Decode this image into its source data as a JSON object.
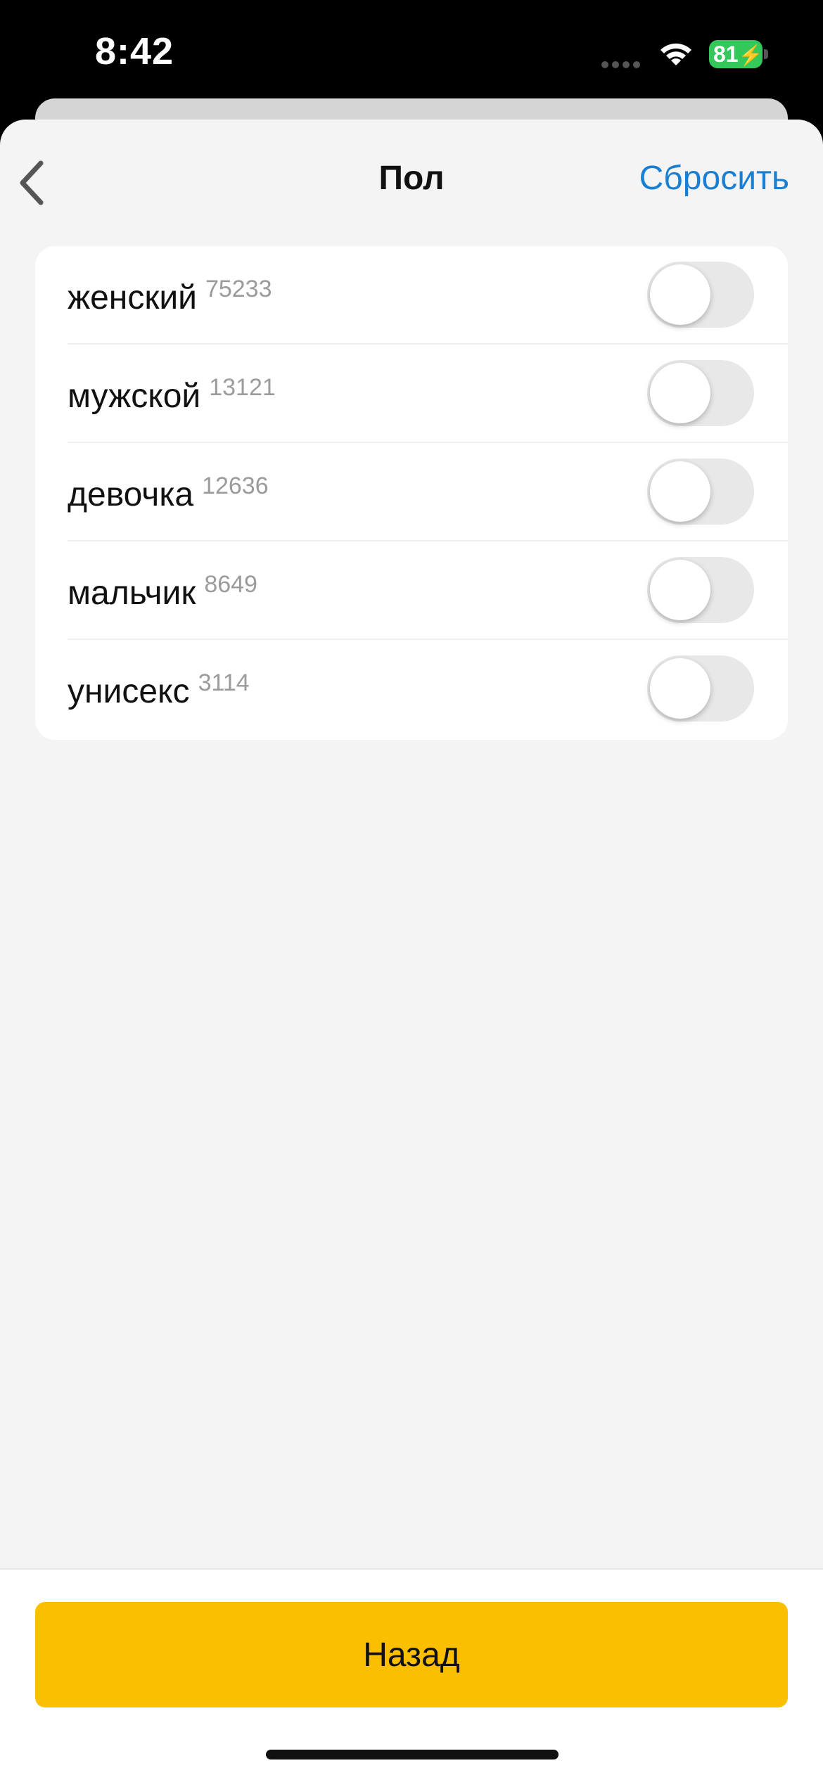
{
  "status_bar": {
    "time": "8:42",
    "battery": "81"
  },
  "nav": {
    "title": "Пол",
    "reset_label": "Сбросить"
  },
  "options": [
    {
      "label": "женский",
      "count": "75233",
      "checked": false
    },
    {
      "label": "мужской",
      "count": "13121",
      "checked": false
    },
    {
      "label": "девочка",
      "count": "12636",
      "checked": false
    },
    {
      "label": "мальчик",
      "count": "8649",
      "checked": false
    },
    {
      "label": "унисекс",
      "count": "3114",
      "checked": false
    }
  ],
  "footer": {
    "back_button_label": "Назад"
  },
  "colors": {
    "accent": "#fcbf00",
    "link": "#1a7ed1",
    "battery": "#34c759"
  },
  "icons": {
    "back": "chevron-left-icon",
    "wifi": "wifi-icon",
    "cellular": "cellular-icon",
    "battery": "battery-charging-icon"
  }
}
